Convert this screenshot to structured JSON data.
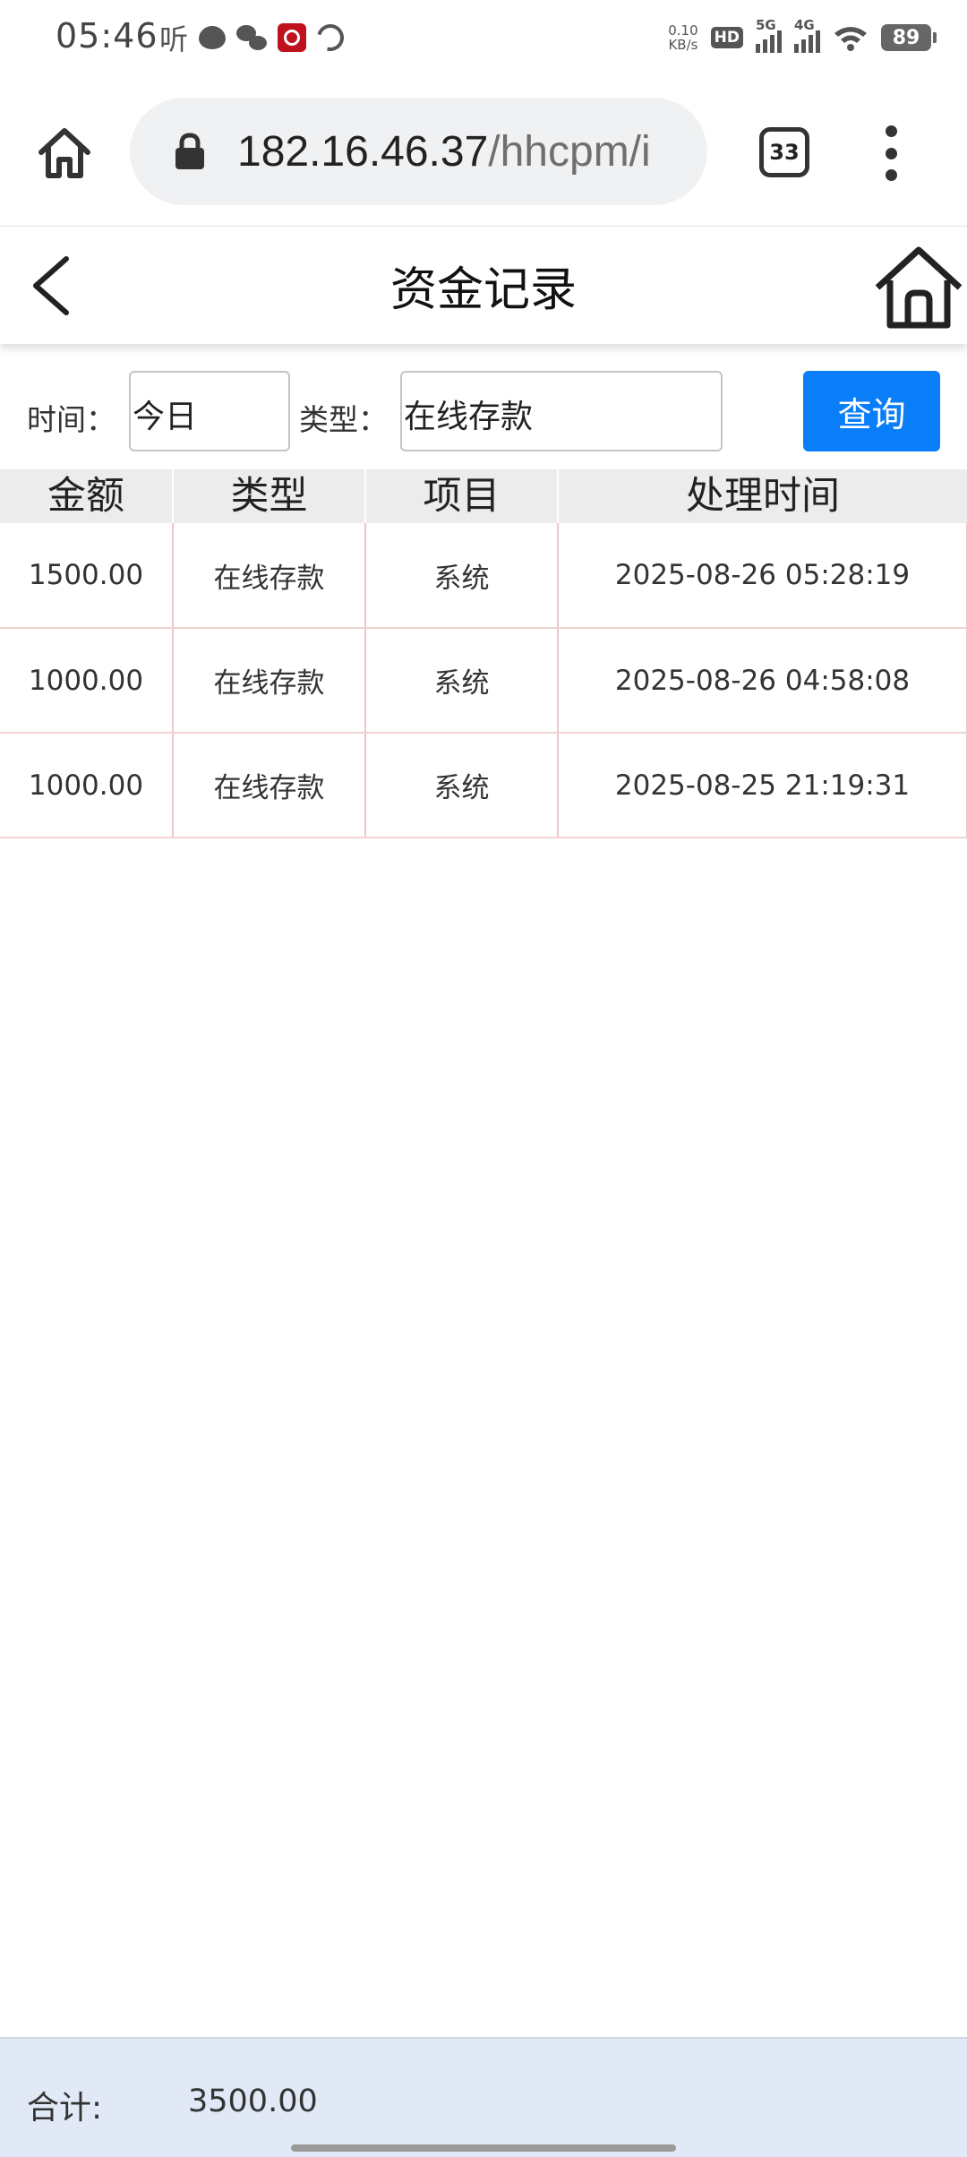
{
  "status_bar": {
    "time": "05:46",
    "notif_ting": "听",
    "net_speed_value": "0.10",
    "net_speed_unit": "KB/s",
    "hd": "HD",
    "sim1_label": "5G",
    "sim2_label": "4G",
    "battery": "89"
  },
  "browser": {
    "url_host": "182.16.46.37",
    "url_path": "/hhcpm/i",
    "tab_count": "33"
  },
  "page": {
    "title": "资金记录"
  },
  "filter": {
    "time_label": "时间：",
    "time_value": "今日",
    "type_label": "类型：",
    "type_value": "在线存款",
    "query_button": "查询"
  },
  "table": {
    "headers": [
      "金额",
      "类型",
      "项目",
      "处理时间"
    ],
    "rows": [
      {
        "amount": "1500.00",
        "type": "在线存款",
        "item": "系统",
        "time": "2025-08-26 05:28:19"
      },
      {
        "amount": "1000.00",
        "type": "在线存款",
        "item": "系统",
        "time": "2025-08-26 04:58:08"
      },
      {
        "amount": "1000.00",
        "type": "在线存款",
        "item": "系统",
        "time": "2025-08-25 21:19:31"
      }
    ]
  },
  "footer": {
    "total_label": "合计:",
    "total_value": "3500.00"
  },
  "colors": {
    "accent": "#0a7ef8",
    "footer_bg": "#e2e9f6",
    "row_border": "#f0c6c6"
  }
}
